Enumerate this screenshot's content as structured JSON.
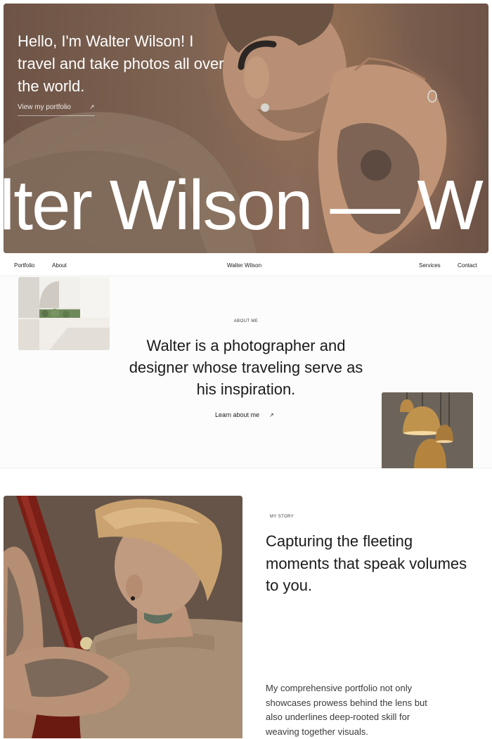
{
  "hero": {
    "greeting": "Hello, I'm Walter Wilson! I travel and take photos all over the world.",
    "cta_label": "View my portfolio",
    "cta_icon": "arrow-up-right-icon",
    "marquee_text": "lter Wilson — W"
  },
  "nav": {
    "items_left": [
      "Portfolio",
      "About"
    ],
    "brand": "Walter Wilson",
    "items_right": [
      "Services",
      "Contact"
    ]
  },
  "about": {
    "label": "ABOUT ME",
    "heading": "Walter is a photographer and designer whose traveling serve as his inspiration.",
    "cta_label": "Learn about me",
    "cta_icon": "arrow-up-right-icon"
  },
  "story": {
    "label": "MY STORY",
    "heading": "Capturing the fleeting moments that speak volumes to you.",
    "body": "My comprehensive portfolio not only showcases prowess behind the lens but also underlines deep-rooted skill for weaving together visuals."
  },
  "colors": {
    "hero_tone": "#7d6251",
    "text": "#1b1b1b",
    "lamp_gold": "#b98a45"
  }
}
